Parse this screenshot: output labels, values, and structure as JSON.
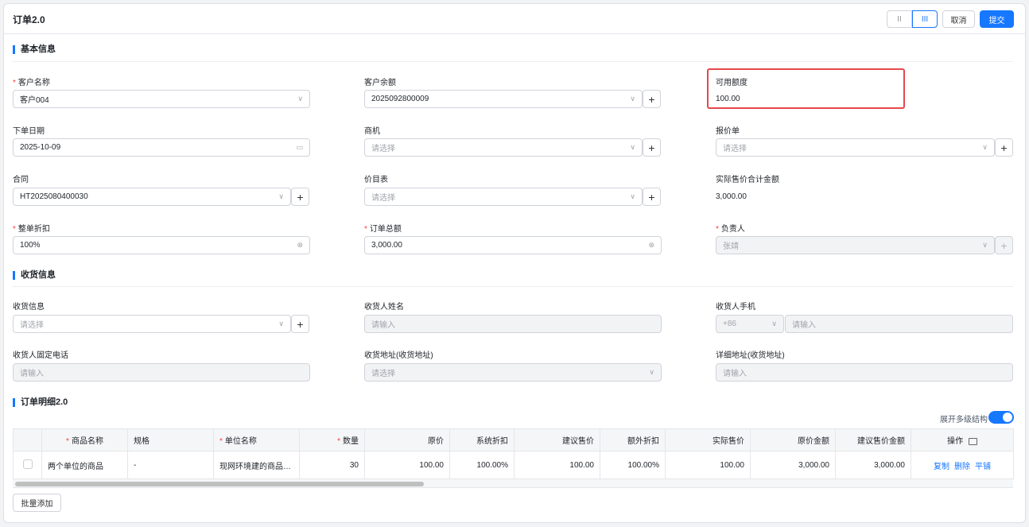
{
  "header": {
    "title": "订单2.0",
    "view_compact": "II",
    "view_wide": "III",
    "cancel": "取消",
    "submit": "提交"
  },
  "sections": {
    "basic": "基本信息",
    "shipping": "收货信息",
    "detail": "订单明细2.0"
  },
  "basic": {
    "customer_name": {
      "label": "客户名称",
      "value": "客户004"
    },
    "customer_balance": {
      "label": "客户余额",
      "value": "2025092800009"
    },
    "available_credit": {
      "label": "可用额度",
      "value": "100.00"
    },
    "order_date": {
      "label": "下单日期",
      "value": "2025-10-09"
    },
    "opportunity": {
      "label": "商机",
      "placeholder": "请选择"
    },
    "quote": {
      "label": "报价单",
      "placeholder": "请选择"
    },
    "contract": {
      "label": "合同",
      "value": "HT2025080400030"
    },
    "price_list": {
      "label": "价目表",
      "placeholder": "请选择"
    },
    "actual_total": {
      "label": "实际售价合计金额",
      "value": "3,000.00"
    },
    "discount": {
      "label": "整单折扣",
      "value": "100%"
    },
    "order_total": {
      "label": "订单总额",
      "value": "3,000.00"
    },
    "owner": {
      "label": "负责人",
      "value": "张靖"
    }
  },
  "shipping": {
    "info": {
      "label": "收货信息",
      "placeholder": "请选择"
    },
    "name": {
      "label": "收货人姓名",
      "placeholder": "请输入"
    },
    "phone": {
      "label": "收货人手机",
      "code": "+86",
      "placeholder": "请输入"
    },
    "landline": {
      "label": "收货人固定电话",
      "placeholder": "请输入"
    },
    "address": {
      "label": "收货地址(收货地址)",
      "placeholder": "请选择"
    },
    "detail_address": {
      "label": "详细地址(收货地址)",
      "placeholder": "请输入"
    }
  },
  "detail": {
    "expand_label": "展开多级结构",
    "expand_on": true,
    "columns": [
      "商品名称",
      "规格",
      "单位名称",
      "数量",
      "原价",
      "系统折扣",
      "建议售价",
      "额外折扣",
      "实际售价",
      "原价金额",
      "建议售价金额",
      "操作"
    ],
    "rows": [
      {
        "name": "两个单位的商品",
        "spec": "-",
        "unit": "现网环境建的商品单位",
        "qty": "30",
        "price": "100.00",
        "sys_discount": "100.00%",
        "suggested": "100.00",
        "extra_discount": "100.00%",
        "actual": "100.00",
        "amount": "3,000.00",
        "suggested_amount": "3,000.00",
        "actions": [
          "复制",
          "删除",
          "平铺"
        ]
      }
    ],
    "batch_add": "批量添加"
  }
}
